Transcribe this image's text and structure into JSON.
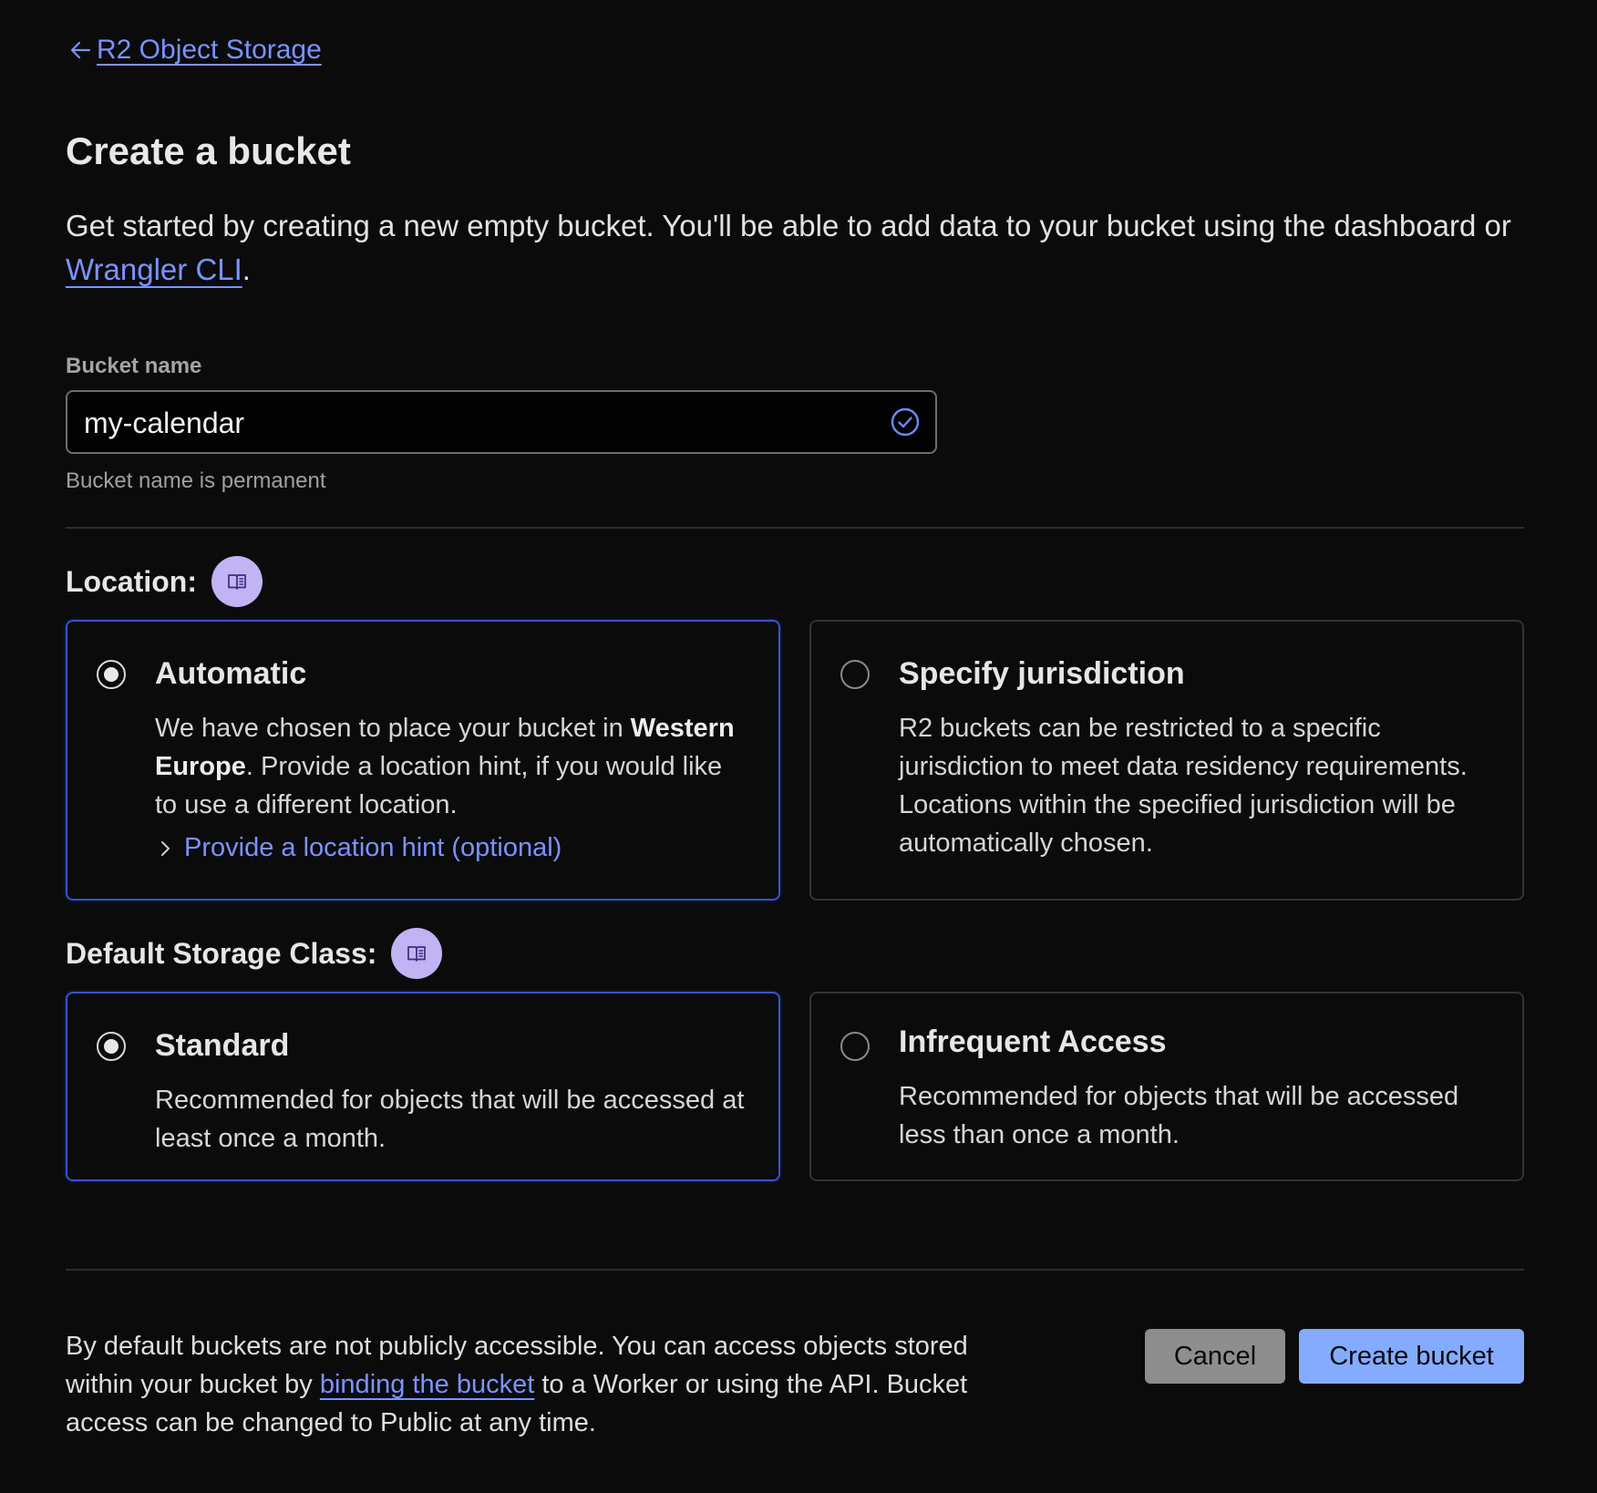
{
  "breadcrumb": {
    "back_label": "R2 Object Storage",
    "icon": "arrow-left-icon"
  },
  "page": {
    "title": "Create a bucket",
    "intro_text": "Get started by creating a new empty bucket. You'll be able to add data to your bucket using the dashboard or ",
    "intro_link": "Wrangler CLI",
    "intro_end": "."
  },
  "bucket_name": {
    "label": "Bucket name",
    "value": "my-calendar",
    "valid_icon": "check-circle-icon",
    "hint": "Bucket name is permanent"
  },
  "location": {
    "label": "Location:",
    "docs_icon": "book-icon",
    "options": [
      {
        "title": "Automatic",
        "selected": true,
        "desc_before": "We have chosen to place your bucket in ",
        "desc_bold": "Western Europe",
        "desc_after": ". Provide a location hint, if you would like to use a different location.",
        "hint_toggle": "Provide a location hint (optional)",
        "hint_icon": "chevron-right-icon"
      },
      {
        "title": "Specify jurisdiction",
        "selected": false,
        "desc": "R2 buckets can be restricted to a specific jurisdiction to meet data residency requirements. Locations within the specified jurisdiction will be automatically chosen."
      }
    ]
  },
  "storage_class": {
    "label": "Default Storage Class:",
    "docs_icon": "book-icon",
    "options": [
      {
        "title": "Standard",
        "selected": true,
        "desc": "Recommended for objects that will be accessed at least once a month."
      },
      {
        "title": "Infrequent Access",
        "selected": false,
        "desc": "Recommended for objects that will be accessed less than once a month."
      }
    ]
  },
  "footer": {
    "text_before": "By default buckets are not publicly accessible. You can access objects stored within your bucket by ",
    "link": "binding the bucket",
    "text_after": " to a Worker or using the API. Bucket access can be changed to Public at any time.",
    "cancel_label": "Cancel",
    "create_label": "Create bucket"
  },
  "colors": {
    "background": "#0b0b0c",
    "link": "#7b93ff",
    "selected_border": "#3454d1",
    "primary_button": "#85abff",
    "secondary_button": "#8e8e8e",
    "docs_badge": "#c1b3f4"
  }
}
